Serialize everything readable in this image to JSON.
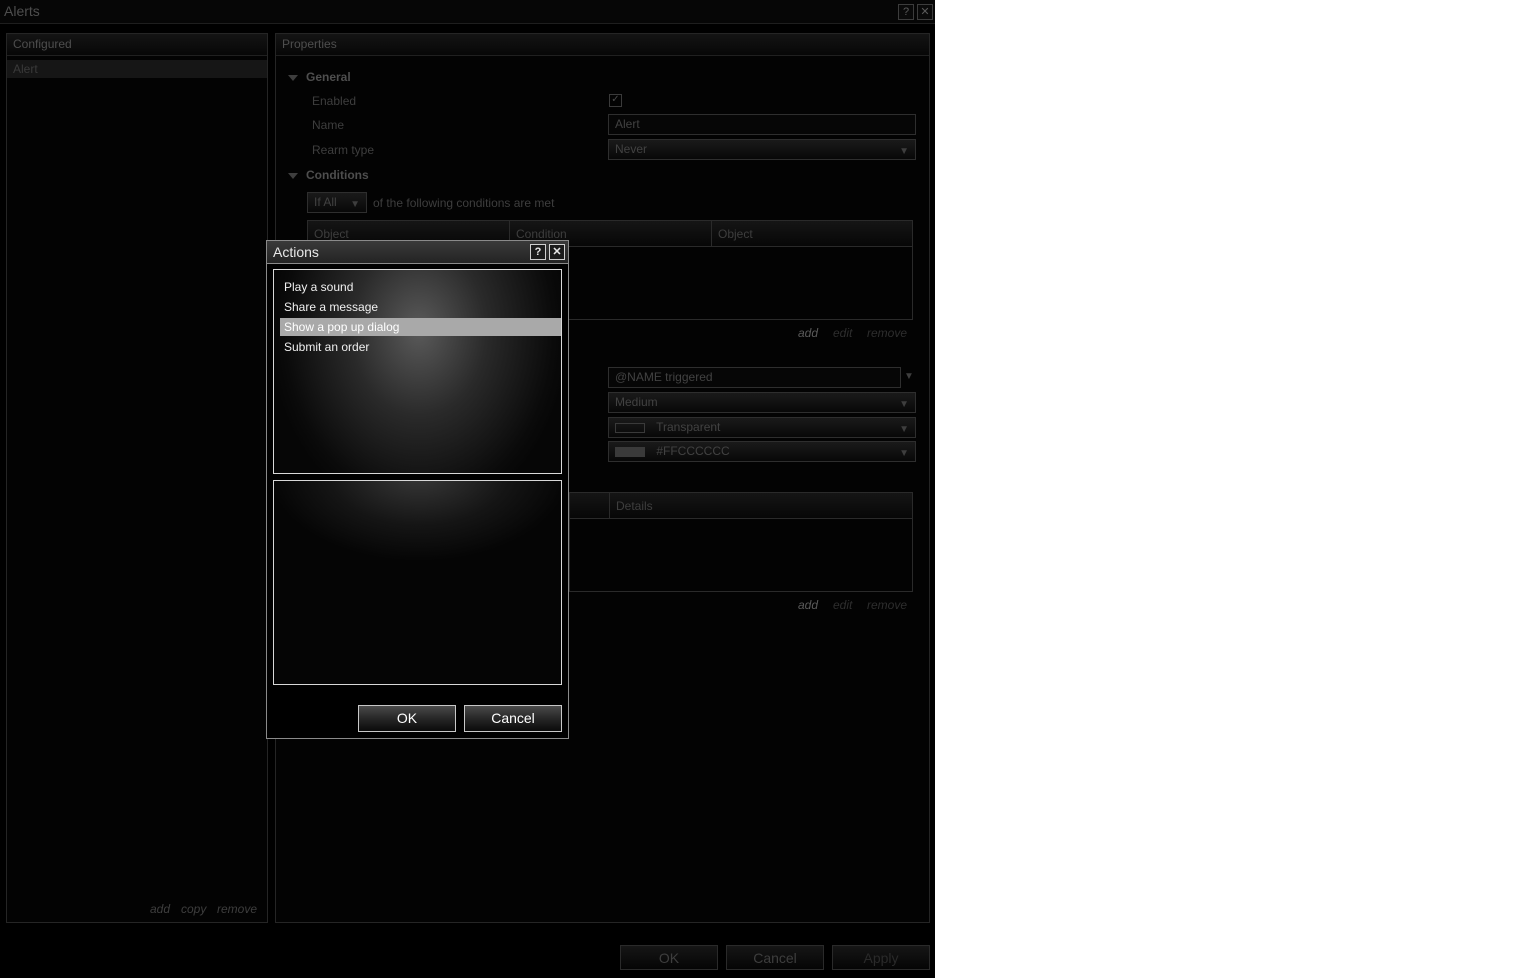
{
  "window": {
    "title": "Alerts",
    "help_glyph": "?",
    "close_glyph": "✕"
  },
  "configured": {
    "header": "Configured",
    "items": [
      "Alert"
    ],
    "links": {
      "add": "add",
      "copy": "copy",
      "remove": "remove"
    }
  },
  "properties": {
    "header": "Properties",
    "general": {
      "title": "General",
      "enabled_label": "Enabled",
      "enabled_checked": true,
      "name_label": "Name",
      "name_value": "Alert",
      "rearm_label": "Rearm type",
      "rearm_value": "Never"
    },
    "conditions": {
      "title": "Conditions",
      "match_value": "If All",
      "match_suffix": "of the following conditions are met",
      "columns": [
        "Object",
        "Condition",
        "Object"
      ],
      "links": {
        "add": "add",
        "edit": "edit",
        "remove": "remove"
      }
    },
    "message": {
      "text_value": "@NAME triggered",
      "priority_value": "Medium",
      "background_value": "Transparent",
      "foreground_value": "#FFCCCCCC"
    },
    "actions_table": {
      "columns": [
        "Details"
      ],
      "links": {
        "add": "add",
        "edit": "edit",
        "remove": "remove"
      }
    }
  },
  "footer": {
    "ok": "OK",
    "cancel": "Cancel",
    "apply": "Apply"
  },
  "dialog": {
    "title": "Actions",
    "help_glyph": "?",
    "close_glyph": "✕",
    "items": [
      "Play a sound",
      "Share a message",
      "Show a pop up dialog",
      "Submit an order"
    ],
    "selected_index": 2,
    "ok": "OK",
    "cancel": "Cancel"
  },
  "colors": {
    "background": "#000000",
    "dialog_border": "#8a8a8a",
    "selection": "#a9a9a9",
    "foreground_swatch": "#3a3a3a"
  }
}
